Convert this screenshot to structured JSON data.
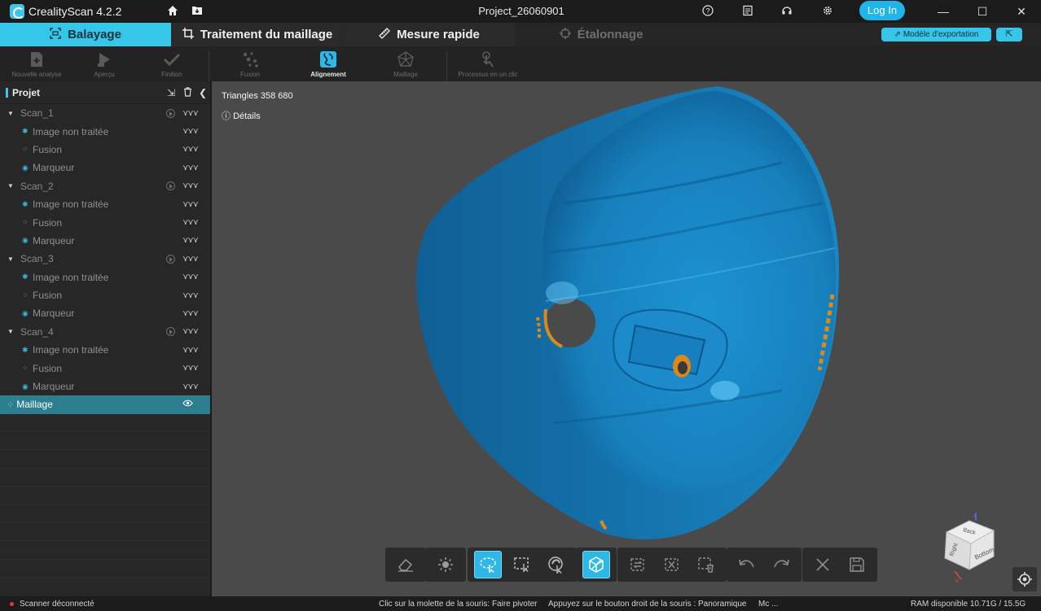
{
  "titlebar": {
    "app_name": "CrealityScan 4.2.2",
    "project_name": "Project_26060901",
    "login_label": "Log In",
    "icons": [
      "home-icon",
      "folder-download-icon",
      "help-icon",
      "list-icon",
      "headset-icon",
      "gear-icon"
    ],
    "window_controls": {
      "minimize": "—",
      "maximize": "☐",
      "close": "✕"
    }
  },
  "tabs": [
    {
      "label": "Balayage",
      "icon": "scan-frame-icon",
      "state": "active"
    },
    {
      "label": "Traitement du maillage",
      "icon": "crop-icon",
      "state": "normal"
    },
    {
      "label": "Mesure rapide",
      "icon": "ruler-icon",
      "state": "normal"
    },
    {
      "label": "Étalonnage",
      "icon": "crosshair-icon",
      "state": "disabled"
    }
  ],
  "export_button": "Modèle d'exportation",
  "toolbar": {
    "tools": [
      {
        "label": "Nouvelle analyse",
        "icon": "new-document-icon",
        "active": false
      },
      {
        "label": "Aperçu",
        "icon": "preview-icon",
        "active": false
      },
      {
        "label": "Finition",
        "icon": "check-icon",
        "active": false
      },
      {
        "label": "Fusion",
        "icon": "fusion-icon",
        "active": false
      },
      {
        "label": "Alignement",
        "icon": "alignment-icon",
        "active": true
      },
      {
        "label": "Maillage",
        "icon": "mesh-icon",
        "active": false
      },
      {
        "label": "Processus en un clic",
        "icon": "one-click-icon",
        "active": false
      }
    ]
  },
  "panel": {
    "title": "Projet",
    "scans": [
      {
        "name": "Scan_1",
        "children": [
          "Image non traitée",
          "Fusion",
          "Marqueur"
        ]
      },
      {
        "name": "Scan_2",
        "children": [
          "Image non traitée",
          "Fusion",
          "Marqueur"
        ]
      },
      {
        "name": "Scan_3",
        "children": [
          "Image non traitée",
          "Fusion",
          "Marqueur"
        ]
      },
      {
        "name": "Scan_4",
        "children": [
          "Image non traitée",
          "Fusion",
          "Marqueur"
        ]
      }
    ],
    "mesh_label": "Maillage"
  },
  "viewport": {
    "triangles": "Triangles 358 680",
    "details": "Détails",
    "model_color": "#1a86c3",
    "highlight_color": "#d88a1c",
    "navcube_faces": [
      "Back",
      "Right",
      "Bottom"
    ]
  },
  "bottom_tools": [
    {
      "name": "eraser-icon",
      "on": false
    },
    {
      "name": "lighting-icon",
      "on": false
    },
    {
      "name": "lasso-select-icon",
      "on": true
    },
    {
      "name": "rect-select-icon",
      "on": false
    },
    {
      "name": "brush-select-icon",
      "on": false
    },
    {
      "name": "view-through-icon",
      "on": true
    },
    {
      "name": "invert-selection-icon",
      "on": false
    },
    {
      "name": "clear-selection-icon",
      "on": false
    },
    {
      "name": "delete-selection-icon",
      "on": false
    },
    {
      "name": "undo-icon",
      "on": false
    },
    {
      "name": "redo-icon",
      "on": false
    },
    {
      "name": "cancel-icon",
      "on": false
    },
    {
      "name": "save-icon",
      "on": false
    }
  ],
  "status": {
    "scanner": "Scanner déconnecté",
    "hint1": "Clic sur la molette de la souris: Faire pivoter",
    "hint2": "Appuyez sur le bouton droit de la souris : Panoramique",
    "hint3": "Mc ...",
    "ram": "RAM disponible 10.71G / 15.5G"
  }
}
